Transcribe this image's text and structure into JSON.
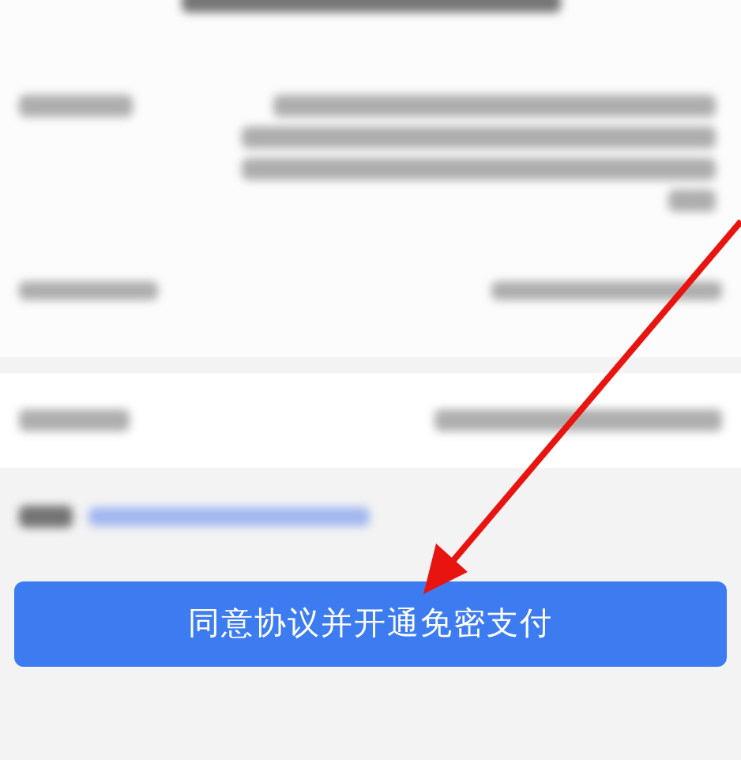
{
  "confirm_button": {
    "label": "同意协议并开通免密支付"
  }
}
